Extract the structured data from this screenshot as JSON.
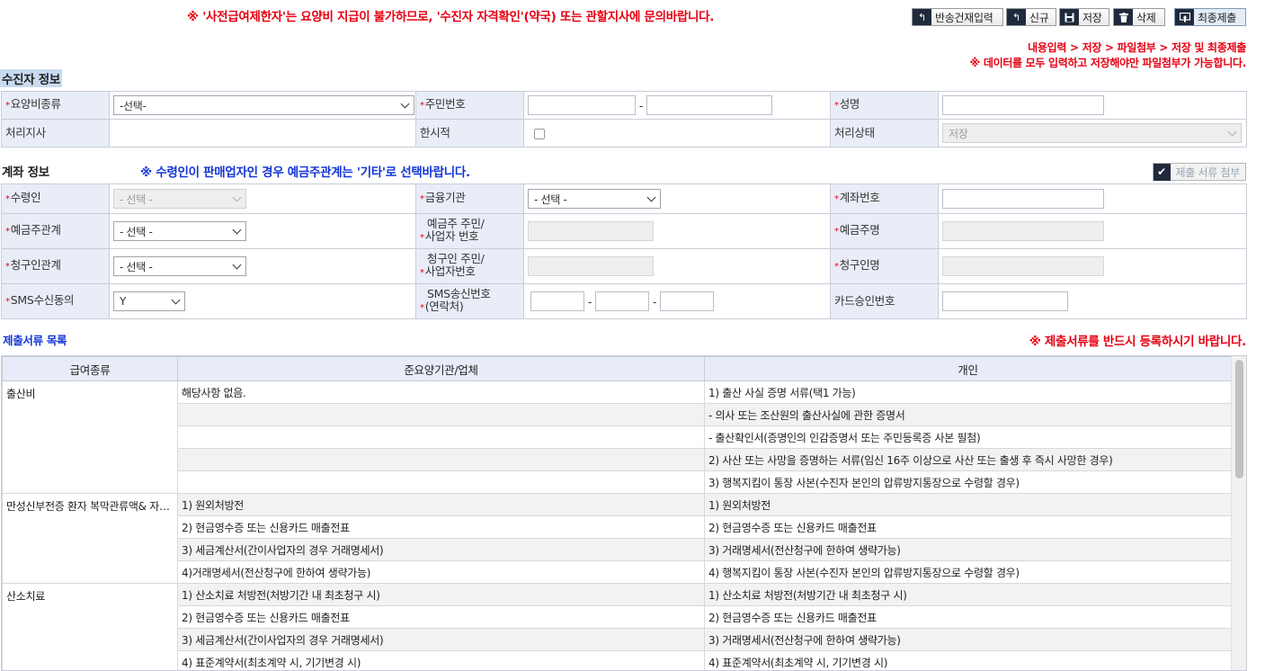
{
  "notice": "※ '사전급여제한자'는 요양비 지급이 불가하므로, '수진자 자격확인'(약국) 또는 관할지사에 문의바랍니다.",
  "toolbar": {
    "return_input": "반송건재입력",
    "new": "신규",
    "save": "저장",
    "delete": "삭제",
    "final_submit": "최종제출"
  },
  "hints": {
    "steps": "내용입력 > 저장 > 파일첨부 > 저장 및 최종제출",
    "save_first": "※ 데이터를 모두 입력하고 저장해야만 파일첨부가 가능합니다."
  },
  "patient": {
    "title": "수진자 정보",
    "care_type_label": "요양비종류",
    "care_type_value": "-선택-",
    "rrn_label": "주민번호",
    "name_label": "성명",
    "branch_label": "처리지사",
    "temporary_label": "한시적",
    "status_label": "처리상태",
    "status_value": "저장"
  },
  "account": {
    "title": "계좌 정보",
    "note": "※ 수령인이 판매업자인 경우 예금주관계는 '기타'로 선택바랍니다.",
    "attach_label": "제출 서류 첨부",
    "receiver_label": "수령인",
    "receiver_value": "- 선택 -",
    "bank_label": "금융기관",
    "bank_value": "- 선택 -",
    "account_no_label": "계좌번호",
    "holder_rel_label": "예금주관계",
    "holder_rel_value": "- 선택 -",
    "holder_id_label_1": "예금주 주민/",
    "holder_id_label_2": "사업자 번호",
    "holder_name_label": "예금주명",
    "claimant_rel_label": "청구인관계",
    "claimant_rel_value": "- 선택 -",
    "claimant_id_label_1": "청구인 주민/",
    "claimant_id_label_2": "사업자번호",
    "claimant_name_label": "청구인명",
    "sms_consent_label": "SMS수신동의",
    "sms_consent_value": "Y",
    "sms_number_label_1": "SMS송신번호",
    "sms_number_label_2": "(연락처)",
    "card_approval_label": "카드승인번호"
  },
  "documents": {
    "title": "제출서류 목록",
    "note": "※ 제출서류를 반드시 등록하시기 바랍니다.",
    "columns": [
      "급여종류",
      "준요양기관/업체",
      "개인"
    ],
    "rows": [
      [
        "출산비",
        "해당사항 없음.",
        "1) 출산 사실 증명 서류(택1 가능)"
      ],
      [
        "",
        "",
        "- 의사 또는 조산원의 출산사실에 관한 증명서"
      ],
      [
        "",
        "",
        "- 출산확인서(증명인의 인감증명서 또는 주민등록증 사본 필첨)"
      ],
      [
        "",
        "",
        "2) 사산 또는 사망을 증명하는 서류(임신 16주 이상으로 사산 또는 출생 후 즉시 사망한 경우)"
      ],
      [
        "",
        "",
        "3) 행복지킴이 통장 사본(수진자 본인의 압류방지통장으로 수령할 경우)"
      ],
      [
        "만성신부전증 환자 복막관류액& 자동복막투석 소모성 재료",
        "1) 원외처방전",
        "1) 원외처방전"
      ],
      [
        "",
        "2) 현금영수증 또는 신용카드 매출전표",
        "2) 현금영수증 또는 신용카드 매출전표"
      ],
      [
        "",
        "3) 세금계산서(간이사업자의 경우 거래명세서)",
        "3) 거래명세서(전산청구에 한하여 생략가능)"
      ],
      [
        "",
        "4)거래명세서(전산청구에 한하여 생략가능)",
        "4) 행복지킴이 통장 사본(수진자 본인의 압류방지통장으로 수령할 경우)"
      ],
      [
        "산소치료",
        "1) 산소치료 처방전(처방기간 내 최초청구 시)",
        "1) 산소치료 처방전(처방기간 내 최초청구 시)"
      ],
      [
        "",
        "2) 현금영수증 또는 신용카드 매출전표",
        "2) 현금영수증 또는 신용카드 매출전표"
      ],
      [
        "",
        "3) 세금계산서(간이사업자의 경우 거래명세서)",
        "3) 거래명세서(전산청구에 한하여 생략가능)"
      ],
      [
        "",
        "4) 표준계약서(최초계약 시, 기기변경 시)",
        "4) 표준계약서(최초계약 시, 기기변경 시)"
      ]
    ]
  }
}
